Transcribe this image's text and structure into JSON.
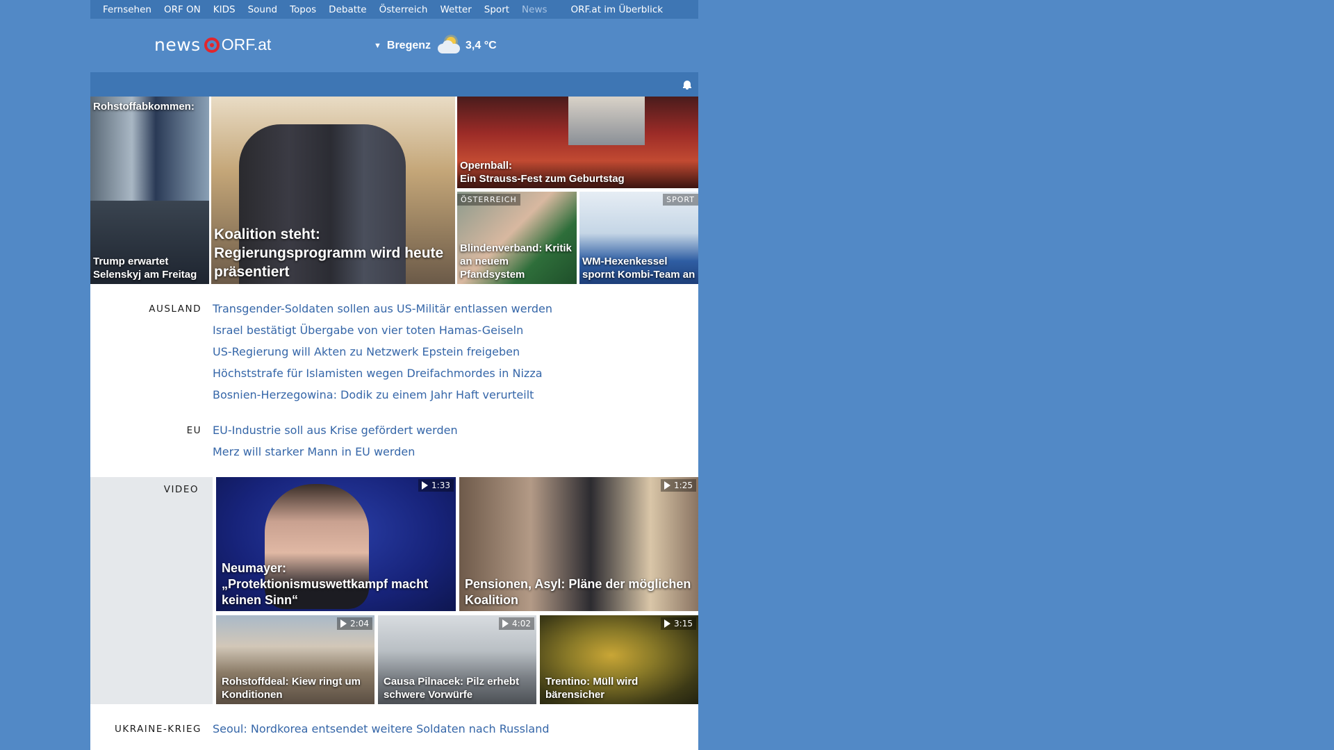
{
  "topnav": {
    "items": [
      "Fernsehen",
      "ORF ON",
      "KIDS",
      "Sound",
      "Topos",
      "Debatte",
      "Österreich",
      "Wetter",
      "Sport",
      "News"
    ],
    "overview": "ORF.at im Überblick"
  },
  "header": {
    "logo_news": "news",
    "logo_orf": "ORF.at",
    "weather_city": "Bregenz",
    "weather_icon": "partly-cloudy-icon",
    "weather_temp": "3,4 °C"
  },
  "hero": {
    "trump": {
      "kicker": "Rohstoffabkommen:",
      "title": "Trump erwartet Selenskyj am Freitag"
    },
    "koalition": {
      "title": "Koalition steht: Regierungsprogramm wird heute präsentiert"
    },
    "opernball": {
      "title_line1": "Opernball:",
      "title_line2": "Ein Strauss-Fest zum Geburtstag"
    },
    "blinden": {
      "tag": "ÖSTERREICH",
      "title": "Blindenverband: Kritik an neuem Pfandsystem"
    },
    "wm": {
      "tag": "SPORT",
      "title": "WM-Hexenkessel spornt Kombi-Team an"
    }
  },
  "ausland": {
    "label": "AUSLAND",
    "links": [
      "Transgender-Soldaten sollen aus US-Militär entlassen werden",
      "Israel bestätigt Übergabe von vier toten Hamas-Geiseln",
      "US-Regierung will Akten zu Netzwerk Epstein freigeben",
      "Höchststrafe für Islamisten wegen Dreifachmordes in Nizza",
      "Bosnien-Herzegowina: Dodik zu einem Jahr Haft verurteilt"
    ]
  },
  "eu": {
    "label": "EU",
    "links": [
      "EU-Industrie soll aus Krise gefördert werden",
      "Merz will starker Mann in EU werden"
    ]
  },
  "video": {
    "label": "VIDEO",
    "items": [
      {
        "title": "Neumayer: „Protektionismuswettkampf macht keinen Sinn“",
        "duration": "1:33"
      },
      {
        "title": "Pensionen, Asyl: Pläne der möglichen Koalition",
        "duration": "1:25"
      },
      {
        "title": "Rohstoffdeal: Kiew ringt um Konditionen",
        "duration": "2:04"
      },
      {
        "title": "Causa Pilnacek: Pilz erhebt schwere Vorwürfe",
        "duration": "4:02"
      },
      {
        "title": "Trentino: Müll wird bärensicher",
        "duration": "3:15"
      }
    ]
  },
  "ukraine": {
    "label": "UKRAINE-KRIEG",
    "links": [
      "Seoul: Nordkorea entsendet weitere Soldaten nach Russland"
    ]
  }
}
